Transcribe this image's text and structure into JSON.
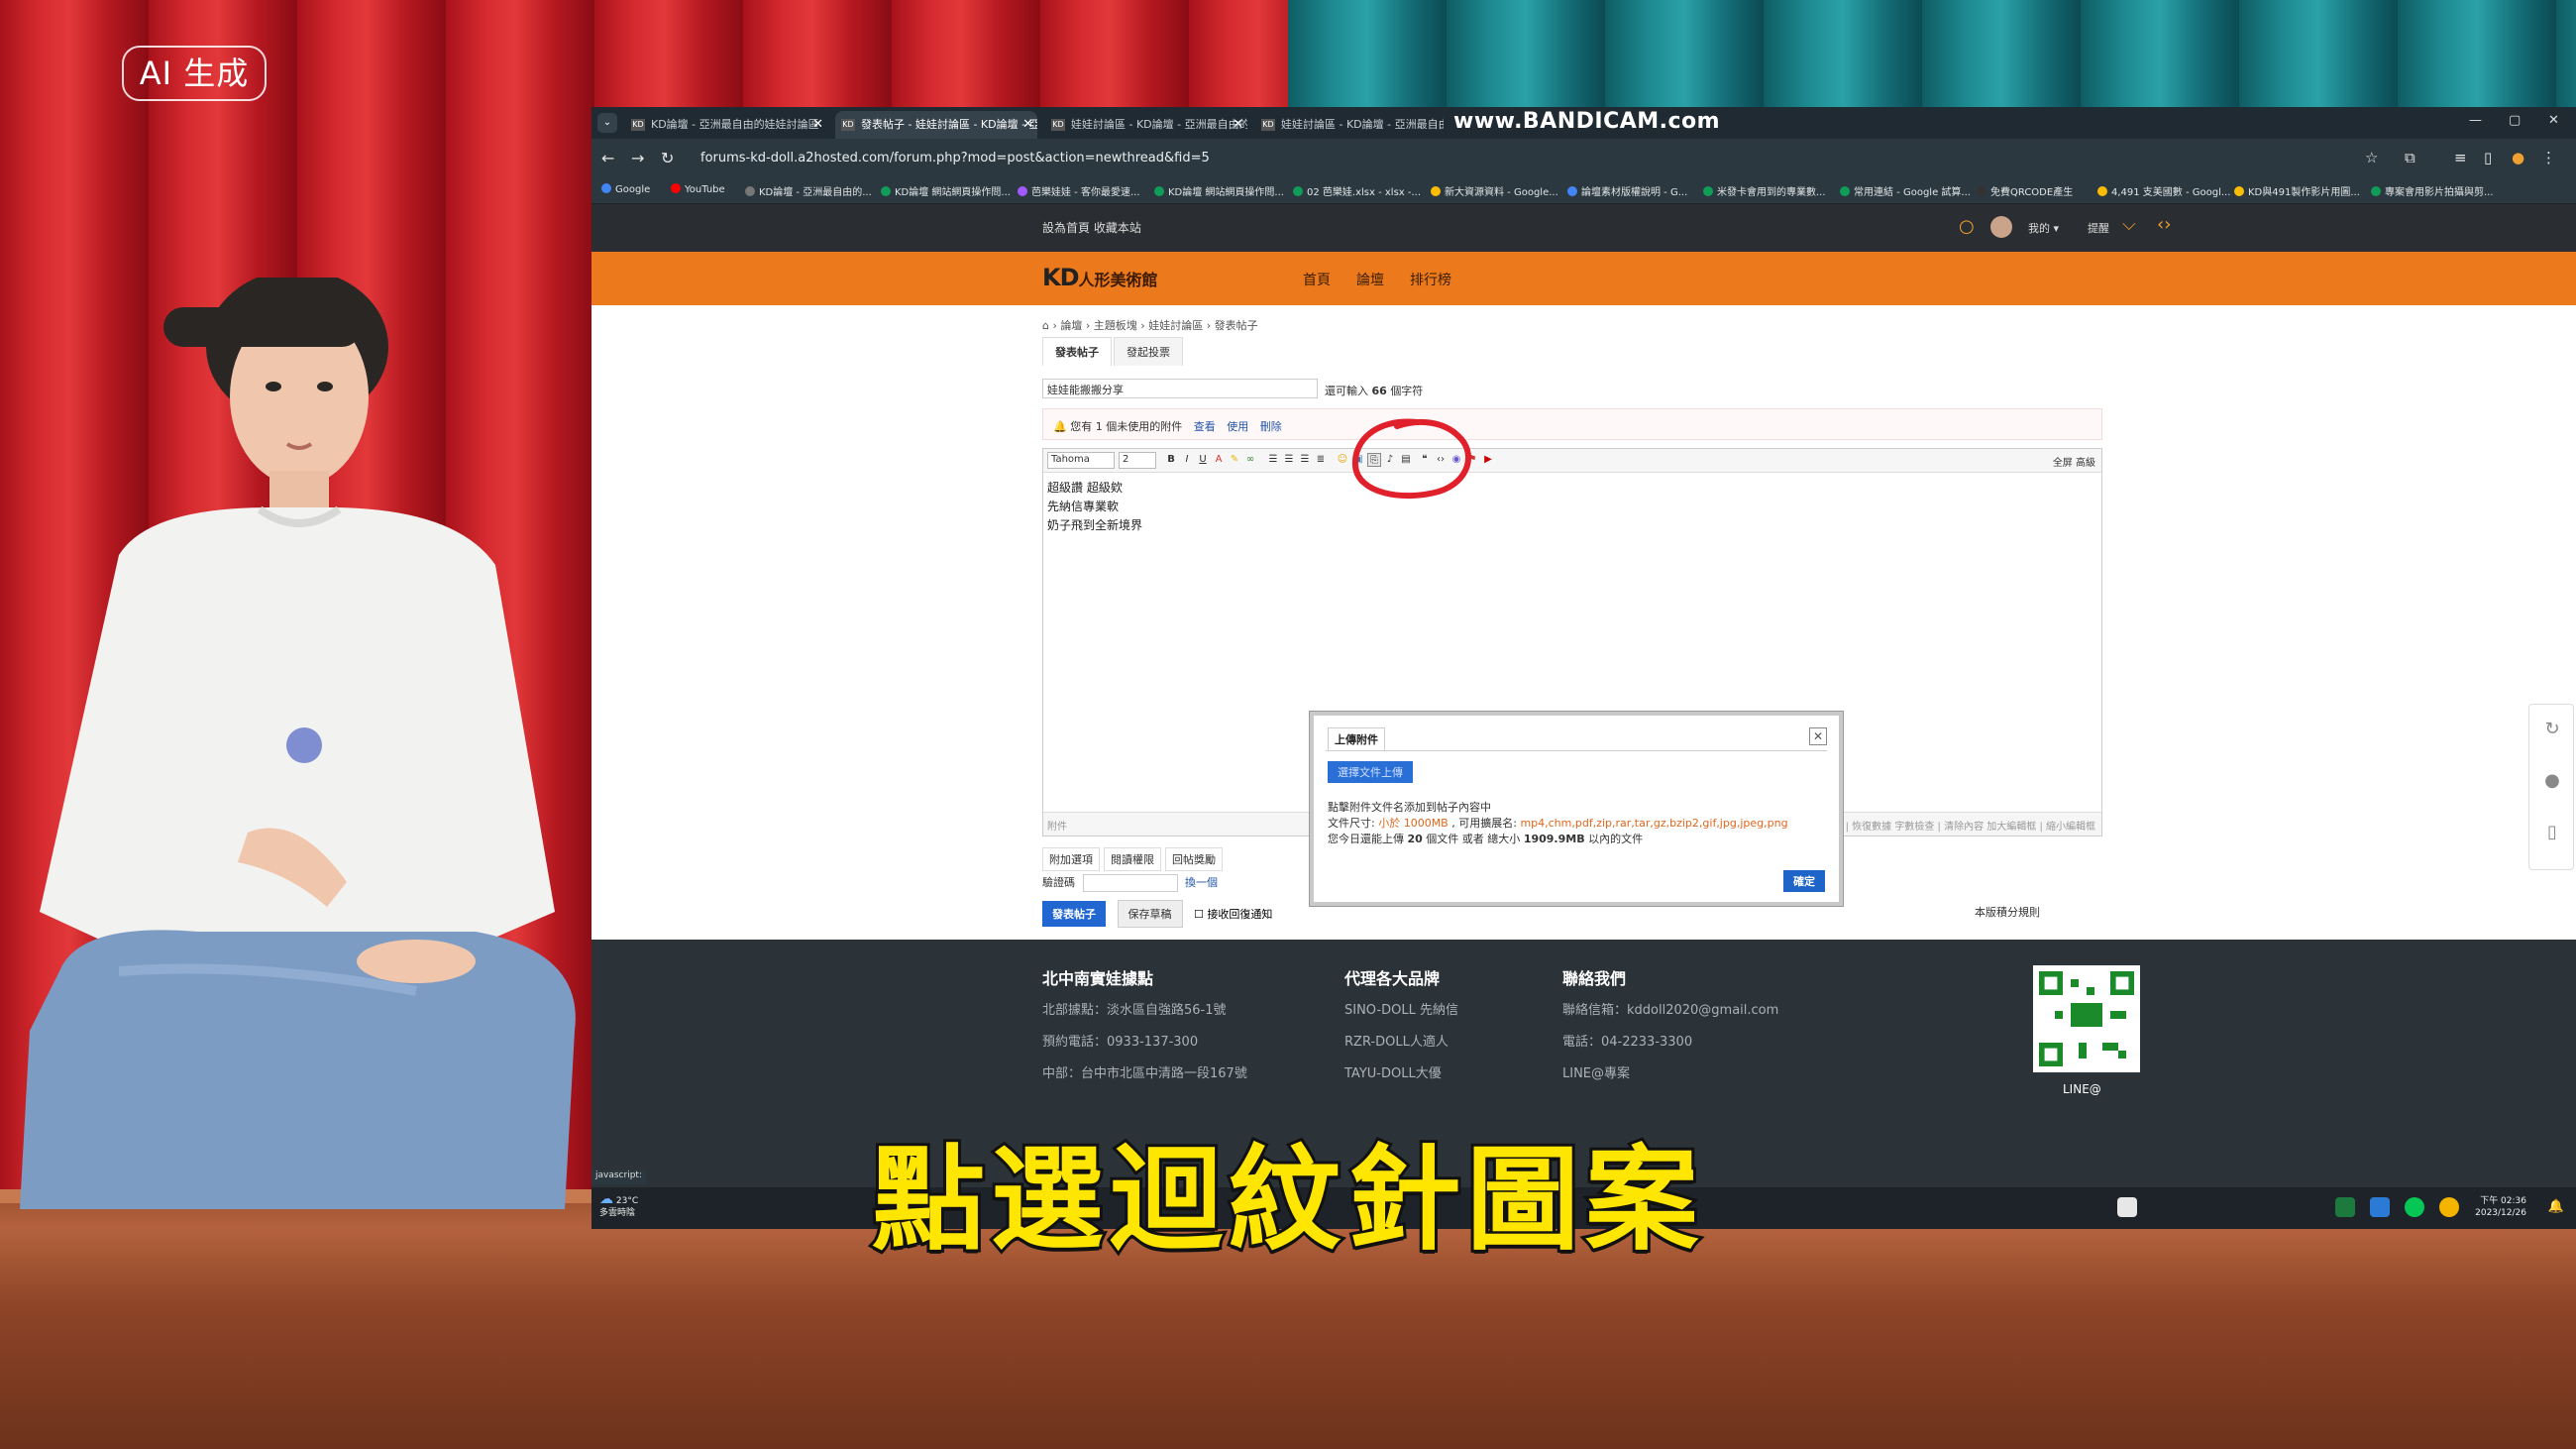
{
  "badge": {
    "ai_label": "AI 生成"
  },
  "subtitle": "點選迴紋針圖案",
  "browser": {
    "tabs": [
      {
        "label": "KD論壇 - 亞洲最自由的娃娃討論區"
      },
      {
        "label": "發表帖子 - 娃娃討論區 - KD論壇 - 亞洲..."
      },
      {
        "label": "娃娃討論區 - KD論壇 - 亞洲最自由的..."
      },
      {
        "label": "娃娃討論區 - KD論壇 - 亞洲最自由的..."
      }
    ],
    "watermark": "www.BANDICAM.com",
    "url": "forums-kd-doll.a2hosted.com/forum.php?mod=post&action=newthread&fid=5",
    "bookmarks": [
      {
        "label": "Google",
        "color": "#4285f4"
      },
      {
        "label": "YouTube",
        "color": "#ff0000"
      },
      {
        "label": "KD論壇 - 亞洲最自由的...",
        "color": "#555555"
      },
      {
        "label": "KD論壇 網站網頁操作問...",
        "color": "#0f9d58"
      },
      {
        "label": "芭樂娃娃 - 客你最愛速...",
        "color": "#a259ff"
      },
      {
        "label": "KD論壇 網站網頁操作問...",
        "color": "#0f9d58"
      },
      {
        "label": "02 芭樂娃.xlsx - xlsx -...",
        "color": "#0f9d58"
      },
      {
        "label": "新大資源資料 - Google...",
        "color": "#fbbc05"
      },
      {
        "label": "論壇素材版權說明 - G...",
        "color": "#4285f4"
      },
      {
        "label": "米發卡會用到的專業數...",
        "color": "#0f9d58"
      },
      {
        "label": "常用連結 - Google 試算...",
        "color": "#0f9d58"
      },
      {
        "label": "免費QRCODE產生",
        "color": "#333333"
      },
      {
        "label": "4,491 支美國數 - Googl...",
        "color": "#fbbc05"
      },
      {
        "label": "KD與491製作影片用圖...",
        "color": "#fbbc05"
      },
      {
        "label": "專案會用影片拍攝與剪...",
        "color": "#0f9d58"
      }
    ]
  },
  "forum": {
    "topbar_links": "設為首頁 收藏本站",
    "user_menu": "我的 ▾",
    "notice_label": "提醒",
    "logo_kd": "KD",
    "logo_text": "人形美術館",
    "nav": [
      "首頁",
      "論壇",
      "排行榜"
    ],
    "breadcrumb": [
      "論壇",
      "主題板塊",
      "娃娃討論區",
      "發表帖子"
    ],
    "post_tabs": [
      "發表帖子",
      "發起投票"
    ],
    "title_value": "娃娃能搬搬分享",
    "title_hint_prefix": "還可輸入",
    "title_hint_count": "66",
    "title_hint_suffix": "個字符",
    "attach_notice": "您有 1 個未使用的附件",
    "attach_links": [
      "查看",
      "使用",
      "刪除"
    ],
    "editor": {
      "font": "Tahoma",
      "size": "2",
      "right_controls": "全屏  高級",
      "body_lines": [
        "超級讚 超級欸",
        "先納信專業軟",
        "奶子飛到全新境界"
      ],
      "footer_left": "附件",
      "footer_right": "10 秒後保存  保存數據 | 恢復數據    字數檢查 | 清除內容    加大編輯框 | 縮小編輯框"
    },
    "upload_dialog": {
      "title": "上傳附件",
      "select_button": "選擇文件上傳",
      "line1": "點擊附件文件名添加到帖子內容中",
      "line2_prefix": "文件尺寸: ",
      "line2_size": "小於 1000MB",
      "line2_mid": " , 可用擴展名: ",
      "line2_exts": "mp4,chm,pdf,zip,rar,tar,gz,bzip2,gif,jpg,jpeg,png",
      "line3_prefix": "您今日還能上傳 ",
      "line3_count": "20",
      "line3_mid": " 個文件 或者 總大小 ",
      "line3_size": "1909.9MB",
      "line3_suffix": " 以內的文件",
      "ok_button": "確定"
    },
    "options": [
      "附加選項",
      "閱讀權限",
      "回帖獎勵"
    ],
    "captcha_label": "驗證碼",
    "captcha_refresh": "換一個",
    "post_button": "發表帖子",
    "draft_button": "保存草稿",
    "reply_notify": "接收回復通知",
    "rules_link": "本版積分規則"
  },
  "footer": {
    "col1": {
      "title": "北中南實娃據點",
      "lines": [
        "北部據點：淡水區自強路56-1號",
        "預約電話：0933-137-300",
        "中部：台中市北區中清路一段167號"
      ]
    },
    "col2": {
      "title": "代理各大品牌",
      "lines": [
        "SINO-DOLL 先納信",
        "RZR-DOLL人適人",
        "TAYU-DOLL大優"
      ]
    },
    "col3": {
      "title": "聯絡我們",
      "lines": [
        "聯絡信箱：kddoll2020@gmail.com",
        "電話：04-2233-3300",
        "LINE@專案"
      ]
    },
    "qr_label": "LINE@"
  },
  "status_bar": "javascript:",
  "taskbar": {
    "weather_temp": "23°C",
    "weather_desc": "多雲時陰",
    "time": "下午 02:36",
    "date": "2023/12/26"
  }
}
